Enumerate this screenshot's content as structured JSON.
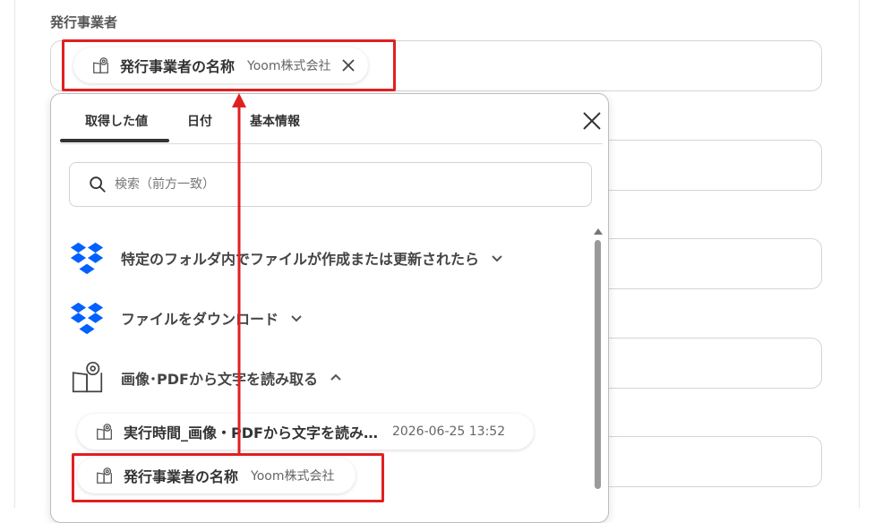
{
  "field": {
    "label": "発行事業者",
    "chip": {
      "name": "発行事業者の名称",
      "value": "Yoom株式会社"
    }
  },
  "dropdown": {
    "tabs": [
      {
        "label": "取得した値",
        "active": true
      },
      {
        "label": "日付",
        "active": false
      },
      {
        "label": "基本情報",
        "active": false
      }
    ],
    "search_placeholder": "検索（前方一致）",
    "steps": [
      {
        "label": "特定のフォルダ内でファイルが作成または更新されたら",
        "icon": "dropbox-icon",
        "expanded": false
      },
      {
        "label": "ファイルをダウンロード",
        "icon": "dropbox-icon",
        "expanded": false
      },
      {
        "label": "画像･PDFから文字を読み取る",
        "icon": "ocr-book-icon",
        "expanded": true
      }
    ],
    "outputs": [
      {
        "name": "実行時間_画像・PDFから文字を読み…",
        "value": "2026-06-25 13:52"
      },
      {
        "name": "発行事業者の名称",
        "value": "Yoom株式会社"
      }
    ]
  },
  "colors": {
    "highlight": "#e02020",
    "dropbox": "#0061fe",
    "text": "#333333"
  }
}
